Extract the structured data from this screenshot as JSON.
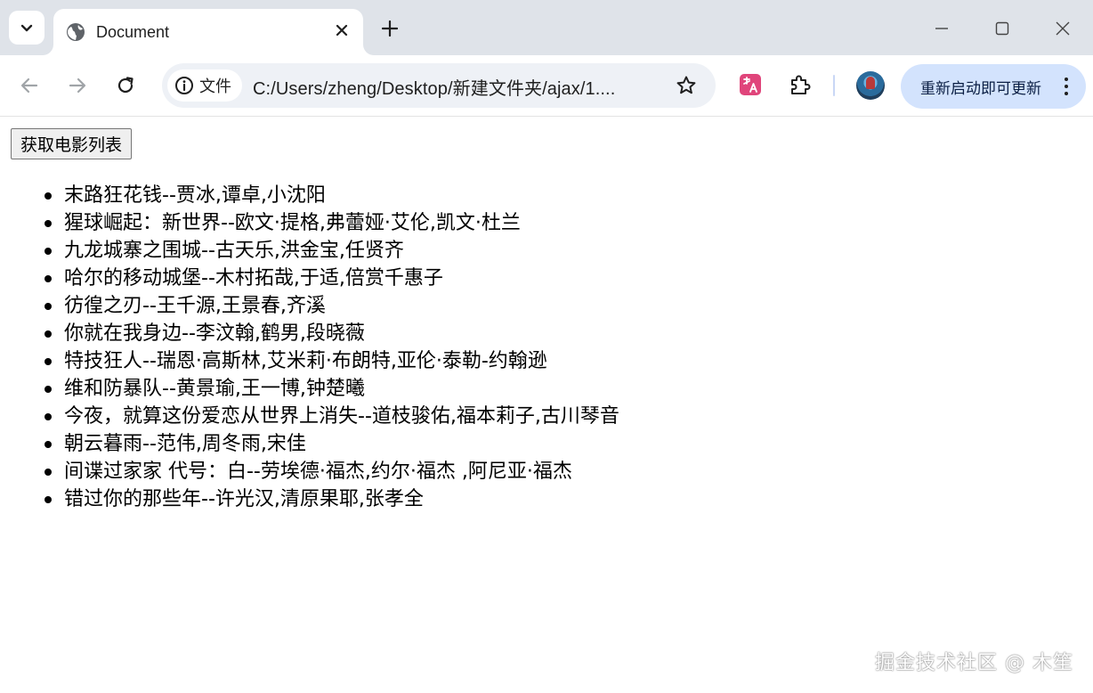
{
  "browser": {
    "tab": {
      "title": "Document"
    },
    "address_bar": {
      "security_chip": "文件",
      "url": "C:/Users/zheng/Desktop/新建文件夹/ajax/1...."
    },
    "update_button": "重新启动即可更新"
  },
  "page": {
    "fetch_button": "获取电影列表",
    "movies": [
      "末路狂花钱--贾冰,谭卓,小沈阳",
      "猩球崛起：新世界--欧文·提格,弗蕾娅·艾伦,凯文·杜兰",
      "九龙城寨之围城--古天乐,洪金宝,任贤齐",
      "哈尔的移动城堡--木村拓哉,于适,倍赏千惠子",
      "彷徨之刃--王千源,王景春,齐溪",
      "你就在我身边--李汶翰,鹤男,段晓薇",
      "特技狂人--瑞恩·高斯林,艾米莉·布朗特,亚伦·泰勒-约翰逊",
      "维和防暴队--黄景瑜,王一博,钟楚曦",
      "今夜，就算这份爱恋从世界上消失--道枝骏佑,福本莉子,古川琴音",
      "朝云暮雨--范伟,周冬雨,宋佳",
      "间谍过家家 代号：白--劳埃德·福杰,约尔·福杰 ,阿尼亚·福杰",
      "错过你的那些年--许光汉,清原果耶,张孝全"
    ],
    "watermark": "掘金技术社区 @ 木笙"
  },
  "colors": {
    "tabstrip_bg": "#dfe3e9",
    "omnibox_bg": "#eef1f6",
    "update_button_bg": "#d3e3fd",
    "translate_ext": "#e0457b"
  },
  "icons": [
    "tab-search-chevron-icon",
    "globe-icon",
    "close-icon",
    "plus-icon",
    "minimize-icon",
    "maximize-icon",
    "window-close-icon",
    "back-icon",
    "forward-icon",
    "reload-icon",
    "info-icon",
    "star-icon",
    "translate-extension-icon",
    "puzzle-extension-icon",
    "more-vert-icon"
  ]
}
